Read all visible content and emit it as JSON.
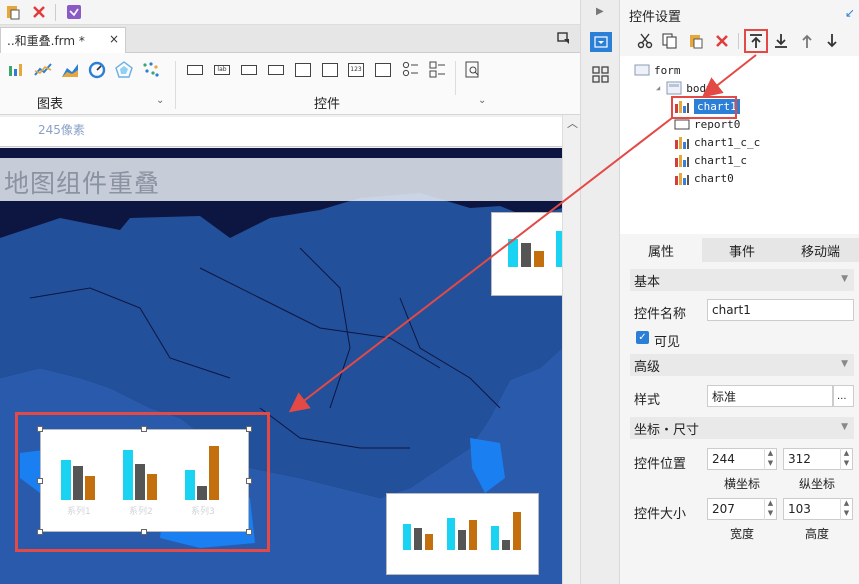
{
  "file_tab": {
    "title": "..和重叠.frm *",
    "close": "×"
  },
  "ribbon": {
    "group_chart": "图表",
    "group_widget": "控件",
    "chev": "⌄"
  },
  "ruler": {
    "text": "245像素"
  },
  "canvas": {
    "title": "地图组件重叠"
  },
  "charts": {
    "main": {
      "categories": [
        "系列1",
        "系列2",
        "系列3"
      ],
      "colors": [
        "#1ad3f2",
        "#555555",
        "#c36f0e"
      ]
    }
  },
  "panel": {
    "title": "控件设置",
    "tree": [
      {
        "label": "form",
        "indent": 0,
        "icon": "form-icon"
      },
      {
        "label": "body",
        "indent": 1,
        "icon": "body-icon"
      },
      {
        "label": "chart1",
        "indent": 2,
        "icon": "chart-icon",
        "selected": true
      },
      {
        "label": "report0",
        "indent": 2,
        "icon": "report-icon"
      },
      {
        "label": "chart1_c_c",
        "indent": 2,
        "icon": "chart-icon"
      },
      {
        "label": "chart1_c",
        "indent": 2,
        "icon": "chart-icon"
      },
      {
        "label": "chart0",
        "indent": 2,
        "icon": "chart-icon"
      }
    ],
    "tabs": {
      "properties": "属性",
      "events": "事件",
      "mobile": "移动端"
    },
    "sections": {
      "basic": "基本",
      "advanced": "高级",
      "coords": "坐标・尺寸"
    },
    "fields": {
      "widget_name_label": "控件名称",
      "widget_name_value": "chart1",
      "visible_label": "可见",
      "style_label": "样式",
      "style_value": "标准",
      "style_btn": "...",
      "position_label": "控件位置",
      "x_value": "244",
      "y_value": "312",
      "x_caption": "横坐标",
      "y_caption": "纵坐标",
      "size_label": "控件大小",
      "w_value": "207",
      "h_value": "103",
      "w_caption": "宽度",
      "h_caption": "高度"
    }
  },
  "accent": "#2b7fd6",
  "highlight": "#e34945"
}
